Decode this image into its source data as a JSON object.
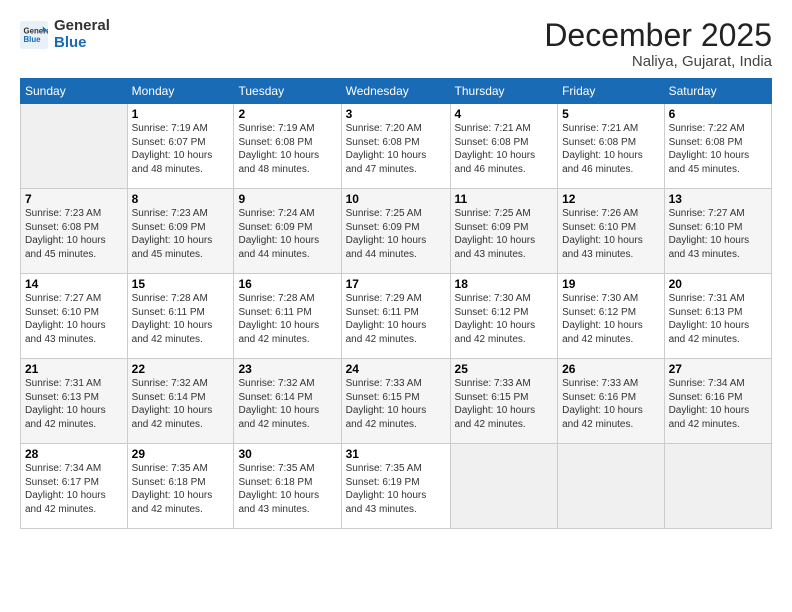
{
  "header": {
    "logo_general": "General",
    "logo_blue": "Blue",
    "month_title": "December 2025",
    "subtitle": "Naliya, Gujarat, India"
  },
  "days_of_week": [
    "Sunday",
    "Monday",
    "Tuesday",
    "Wednesday",
    "Thursday",
    "Friday",
    "Saturday"
  ],
  "weeks": [
    [
      {
        "day": "",
        "empty": true
      },
      {
        "day": "1",
        "sunrise": "Sunrise: 7:19 AM",
        "sunset": "Sunset: 6:07 PM",
        "daylight": "Daylight: 10 hours and 48 minutes."
      },
      {
        "day": "2",
        "sunrise": "Sunrise: 7:19 AM",
        "sunset": "Sunset: 6:08 PM",
        "daylight": "Daylight: 10 hours and 48 minutes."
      },
      {
        "day": "3",
        "sunrise": "Sunrise: 7:20 AM",
        "sunset": "Sunset: 6:08 PM",
        "daylight": "Daylight: 10 hours and 47 minutes."
      },
      {
        "day": "4",
        "sunrise": "Sunrise: 7:21 AM",
        "sunset": "Sunset: 6:08 PM",
        "daylight": "Daylight: 10 hours and 46 minutes."
      },
      {
        "day": "5",
        "sunrise": "Sunrise: 7:21 AM",
        "sunset": "Sunset: 6:08 PM",
        "daylight": "Daylight: 10 hours and 46 minutes."
      },
      {
        "day": "6",
        "sunrise": "Sunrise: 7:22 AM",
        "sunset": "Sunset: 6:08 PM",
        "daylight": "Daylight: 10 hours and 45 minutes."
      }
    ],
    [
      {
        "day": "7",
        "sunrise": "Sunrise: 7:23 AM",
        "sunset": "Sunset: 6:08 PM",
        "daylight": "Daylight: 10 hours and 45 minutes."
      },
      {
        "day": "8",
        "sunrise": "Sunrise: 7:23 AM",
        "sunset": "Sunset: 6:09 PM",
        "daylight": "Daylight: 10 hours and 45 minutes."
      },
      {
        "day": "9",
        "sunrise": "Sunrise: 7:24 AM",
        "sunset": "Sunset: 6:09 PM",
        "daylight": "Daylight: 10 hours and 44 minutes."
      },
      {
        "day": "10",
        "sunrise": "Sunrise: 7:25 AM",
        "sunset": "Sunset: 6:09 PM",
        "daylight": "Daylight: 10 hours and 44 minutes."
      },
      {
        "day": "11",
        "sunrise": "Sunrise: 7:25 AM",
        "sunset": "Sunset: 6:09 PM",
        "daylight": "Daylight: 10 hours and 43 minutes."
      },
      {
        "day": "12",
        "sunrise": "Sunrise: 7:26 AM",
        "sunset": "Sunset: 6:10 PM",
        "daylight": "Daylight: 10 hours and 43 minutes."
      },
      {
        "day": "13",
        "sunrise": "Sunrise: 7:27 AM",
        "sunset": "Sunset: 6:10 PM",
        "daylight": "Daylight: 10 hours and 43 minutes."
      }
    ],
    [
      {
        "day": "14",
        "sunrise": "Sunrise: 7:27 AM",
        "sunset": "Sunset: 6:10 PM",
        "daylight": "Daylight: 10 hours and 43 minutes."
      },
      {
        "day": "15",
        "sunrise": "Sunrise: 7:28 AM",
        "sunset": "Sunset: 6:11 PM",
        "daylight": "Daylight: 10 hours and 42 minutes."
      },
      {
        "day": "16",
        "sunrise": "Sunrise: 7:28 AM",
        "sunset": "Sunset: 6:11 PM",
        "daylight": "Daylight: 10 hours and 42 minutes."
      },
      {
        "day": "17",
        "sunrise": "Sunrise: 7:29 AM",
        "sunset": "Sunset: 6:11 PM",
        "daylight": "Daylight: 10 hours and 42 minutes."
      },
      {
        "day": "18",
        "sunrise": "Sunrise: 7:30 AM",
        "sunset": "Sunset: 6:12 PM",
        "daylight": "Daylight: 10 hours and 42 minutes."
      },
      {
        "day": "19",
        "sunrise": "Sunrise: 7:30 AM",
        "sunset": "Sunset: 6:12 PM",
        "daylight": "Daylight: 10 hours and 42 minutes."
      },
      {
        "day": "20",
        "sunrise": "Sunrise: 7:31 AM",
        "sunset": "Sunset: 6:13 PM",
        "daylight": "Daylight: 10 hours and 42 minutes."
      }
    ],
    [
      {
        "day": "21",
        "sunrise": "Sunrise: 7:31 AM",
        "sunset": "Sunset: 6:13 PM",
        "daylight": "Daylight: 10 hours and 42 minutes."
      },
      {
        "day": "22",
        "sunrise": "Sunrise: 7:32 AM",
        "sunset": "Sunset: 6:14 PM",
        "daylight": "Daylight: 10 hours and 42 minutes."
      },
      {
        "day": "23",
        "sunrise": "Sunrise: 7:32 AM",
        "sunset": "Sunset: 6:14 PM",
        "daylight": "Daylight: 10 hours and 42 minutes."
      },
      {
        "day": "24",
        "sunrise": "Sunrise: 7:33 AM",
        "sunset": "Sunset: 6:15 PM",
        "daylight": "Daylight: 10 hours and 42 minutes."
      },
      {
        "day": "25",
        "sunrise": "Sunrise: 7:33 AM",
        "sunset": "Sunset: 6:15 PM",
        "daylight": "Daylight: 10 hours and 42 minutes."
      },
      {
        "day": "26",
        "sunrise": "Sunrise: 7:33 AM",
        "sunset": "Sunset: 6:16 PM",
        "daylight": "Daylight: 10 hours and 42 minutes."
      },
      {
        "day": "27",
        "sunrise": "Sunrise: 7:34 AM",
        "sunset": "Sunset: 6:16 PM",
        "daylight": "Daylight: 10 hours and 42 minutes."
      }
    ],
    [
      {
        "day": "28",
        "sunrise": "Sunrise: 7:34 AM",
        "sunset": "Sunset: 6:17 PM",
        "daylight": "Daylight: 10 hours and 42 minutes."
      },
      {
        "day": "29",
        "sunrise": "Sunrise: 7:35 AM",
        "sunset": "Sunset: 6:18 PM",
        "daylight": "Daylight: 10 hours and 42 minutes."
      },
      {
        "day": "30",
        "sunrise": "Sunrise: 7:35 AM",
        "sunset": "Sunset: 6:18 PM",
        "daylight": "Daylight: 10 hours and 43 minutes."
      },
      {
        "day": "31",
        "sunrise": "Sunrise: 7:35 AM",
        "sunset": "Sunset: 6:19 PM",
        "daylight": "Daylight: 10 hours and 43 minutes."
      },
      {
        "day": "",
        "empty": true
      },
      {
        "day": "",
        "empty": true
      },
      {
        "day": "",
        "empty": true
      }
    ]
  ]
}
